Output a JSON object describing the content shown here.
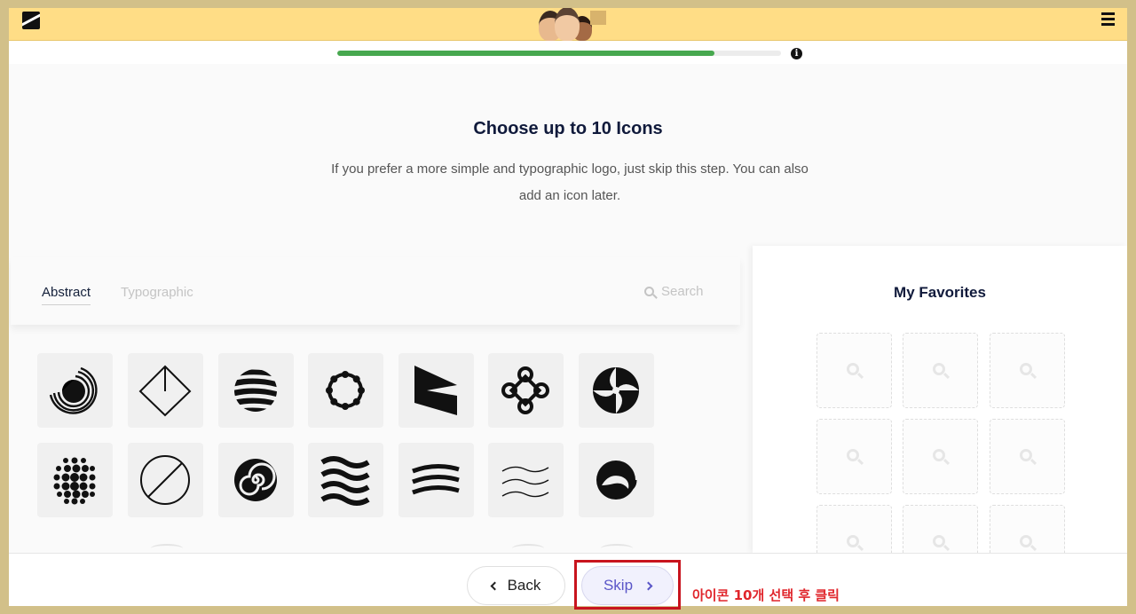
{
  "header": {
    "logo": "brand-logo",
    "menu_icon": "hamburger-menu-icon"
  },
  "progress": {
    "percent": 85
  },
  "step": {
    "title": "Choose up to 10 Icons",
    "subtitle": "If you prefer a more simple and typographic logo, just skip this step. You can also add an icon later."
  },
  "tabs": [
    {
      "label": "Abstract",
      "active": true
    },
    {
      "label": "Typographic",
      "active": false
    }
  ],
  "search": {
    "label": "Search",
    "icon": "search-icon"
  },
  "icons": [
    "concentric-arcs-icon",
    "diamond-line-icon",
    "striped-sphere-icon",
    "bead-ring-icon",
    "flag-triangle-icon",
    "celtic-knot-icon",
    "swirl-blades-icon",
    "dot-sphere-icon",
    "split-circle-icon",
    "spiral-icon",
    "thick-waves-icon",
    "three-waves-icon",
    "thin-waves-icon",
    "wave-circle-icon"
  ],
  "favorites": {
    "title": "My Favorites",
    "slot_count": 9
  },
  "buttons": {
    "back": "Back",
    "skip": "Skip"
  },
  "annotation": {
    "text": "아이콘 10개 선택 후 클릭",
    "color": "#e0262c"
  },
  "colors": {
    "header": "#ffdd86",
    "progress": "#47a84f",
    "skip_text": "#5a56c8"
  }
}
